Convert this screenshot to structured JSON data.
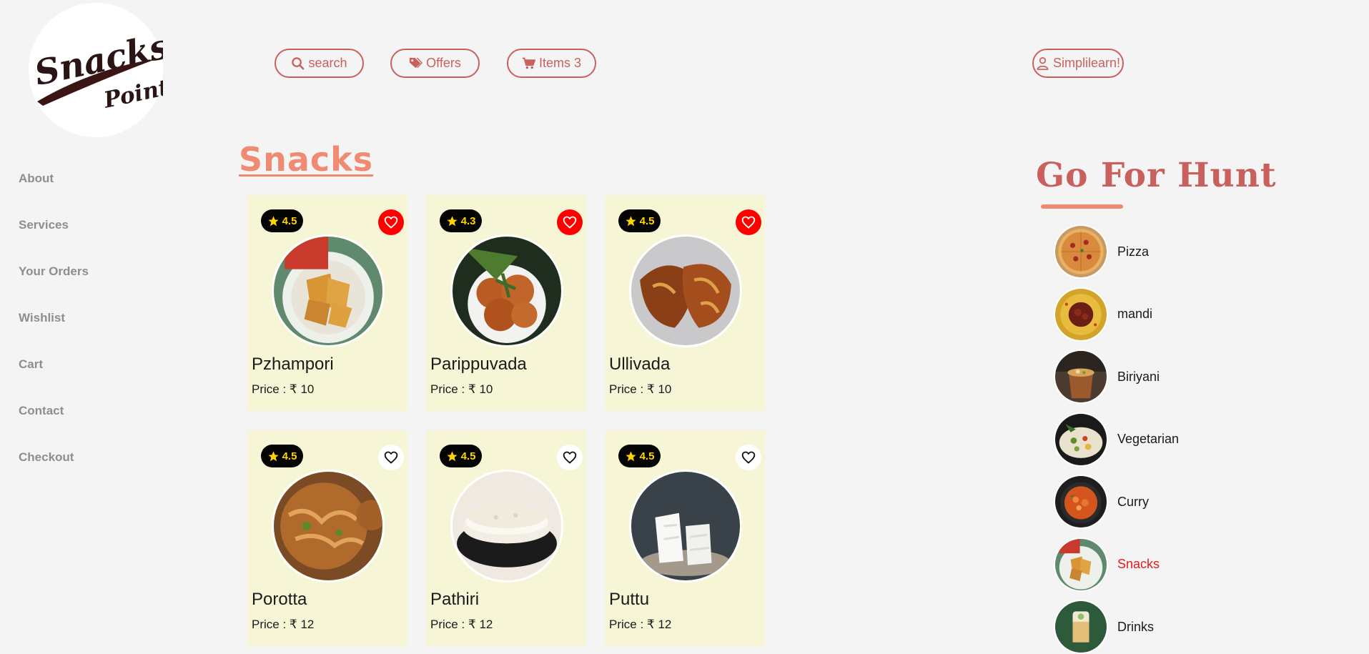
{
  "brand": {
    "logo_line1": "Snacks",
    "logo_line2": "Point"
  },
  "topbar": {
    "search_label": "search",
    "offers_label": "Offers",
    "cart_label": "Items 3",
    "user_label": "Simplilearn!"
  },
  "sidebar": {
    "items": [
      {
        "label": "About"
      },
      {
        "label": "Services"
      },
      {
        "label": "Your Orders"
      },
      {
        "label": "Wishlist"
      },
      {
        "label": "Cart"
      },
      {
        "label": "Contact"
      },
      {
        "label": "Checkout"
      }
    ]
  },
  "main": {
    "title": "Snacks",
    "products": [
      {
        "rating": "4.5",
        "name": "Pzhampori",
        "price": "Price : ₹ 10",
        "liked": true,
        "image": "banana-fritter"
      },
      {
        "rating": "4.3",
        "name": "Parippuvada",
        "price": "Price : ₹ 10",
        "liked": true,
        "image": "lentil-vada"
      },
      {
        "rating": "4.5",
        "name": "Ullivada",
        "price": "Price : ₹ 10",
        "liked": true,
        "image": "onion-fritter"
      },
      {
        "rating": "4.5",
        "name": "Porotta",
        "price": "Price : ₹ 12",
        "liked": false,
        "image": "flatbread-crispy"
      },
      {
        "rating": "4.5",
        "name": "Pathiri",
        "price": "Price : ₹ 12",
        "liked": false,
        "image": "rice-pancake"
      },
      {
        "rating": "4.5",
        "name": "Puttu",
        "price": "Price : ₹ 12",
        "liked": false,
        "image": "steamed-rice-cake"
      }
    ]
  },
  "hunt": {
    "title": "Go For Hunt",
    "categories": [
      {
        "label": "Pizza",
        "active": false,
        "image": "pizza"
      },
      {
        "label": "mandi",
        "active": false,
        "image": "mandi"
      },
      {
        "label": "Biriyani",
        "active": false,
        "image": "biriyani"
      },
      {
        "label": "Vegetarian",
        "active": false,
        "image": "vegetarian"
      },
      {
        "label": "Curry",
        "active": false,
        "image": "curry"
      },
      {
        "label": "Snacks",
        "active": true,
        "image": "snacks"
      },
      {
        "label": "Drinks",
        "active": false,
        "image": "drinks"
      }
    ]
  },
  "colors": {
    "background": "#f4f4f4",
    "accent": "#c9605e",
    "title_accent": "#f08b73",
    "card_bg": "#f6f5d6",
    "rating_star": "#ffd400",
    "heart_active": "#ff0000",
    "active_category": "#e41b1b",
    "nav_text": "#8e8e8e"
  }
}
